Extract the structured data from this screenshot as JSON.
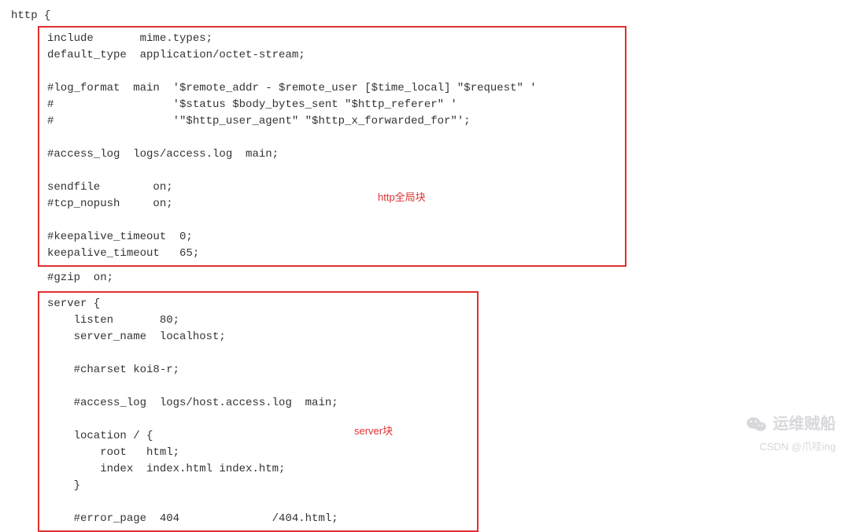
{
  "code": {
    "line0": "http {",
    "box1": {
      "l1": "include       mime.types;",
      "l2": "default_type  application/octet-stream;",
      "blank1": "",
      "l3": "#log_format  main  '$remote_addr - $remote_user [$time_local] \"$request\" '",
      "l4": "#                  '$status $body_bytes_sent \"$http_referer\" '",
      "l5": "#                  '\"$http_user_agent\" \"$http_x_forwarded_for\"';",
      "blank2": "",
      "l6": "#access_log  logs/access.log  main;",
      "blank3": "",
      "l7": "sendfile        on;",
      "l8": "#tcp_nopush     on;",
      "blank4": "",
      "l9": "#keepalive_timeout  0;",
      "l10": "keepalive_timeout   65;"
    },
    "mid": "#gzip  on;",
    "box2": {
      "l1": "server {",
      "l2": "    listen       80;",
      "l3": "    server_name  localhost;",
      "blank1": "",
      "l4": "    #charset koi8-r;",
      "blank2": "",
      "l5": "    #access_log  logs/host.access.log  main;",
      "blank3": "",
      "l6": "    location / {",
      "l7": "        root   html;",
      "l8": "        index  index.html index.htm;",
      "l9": "    }",
      "blank4": "",
      "l10": "    #error_page  404              /404.html;"
    }
  },
  "labels": {
    "http_global": "http全局块",
    "server_block": "server块"
  },
  "watermark": {
    "brand": "运维贼船",
    "sub": "CSDN @爪哇ing"
  }
}
